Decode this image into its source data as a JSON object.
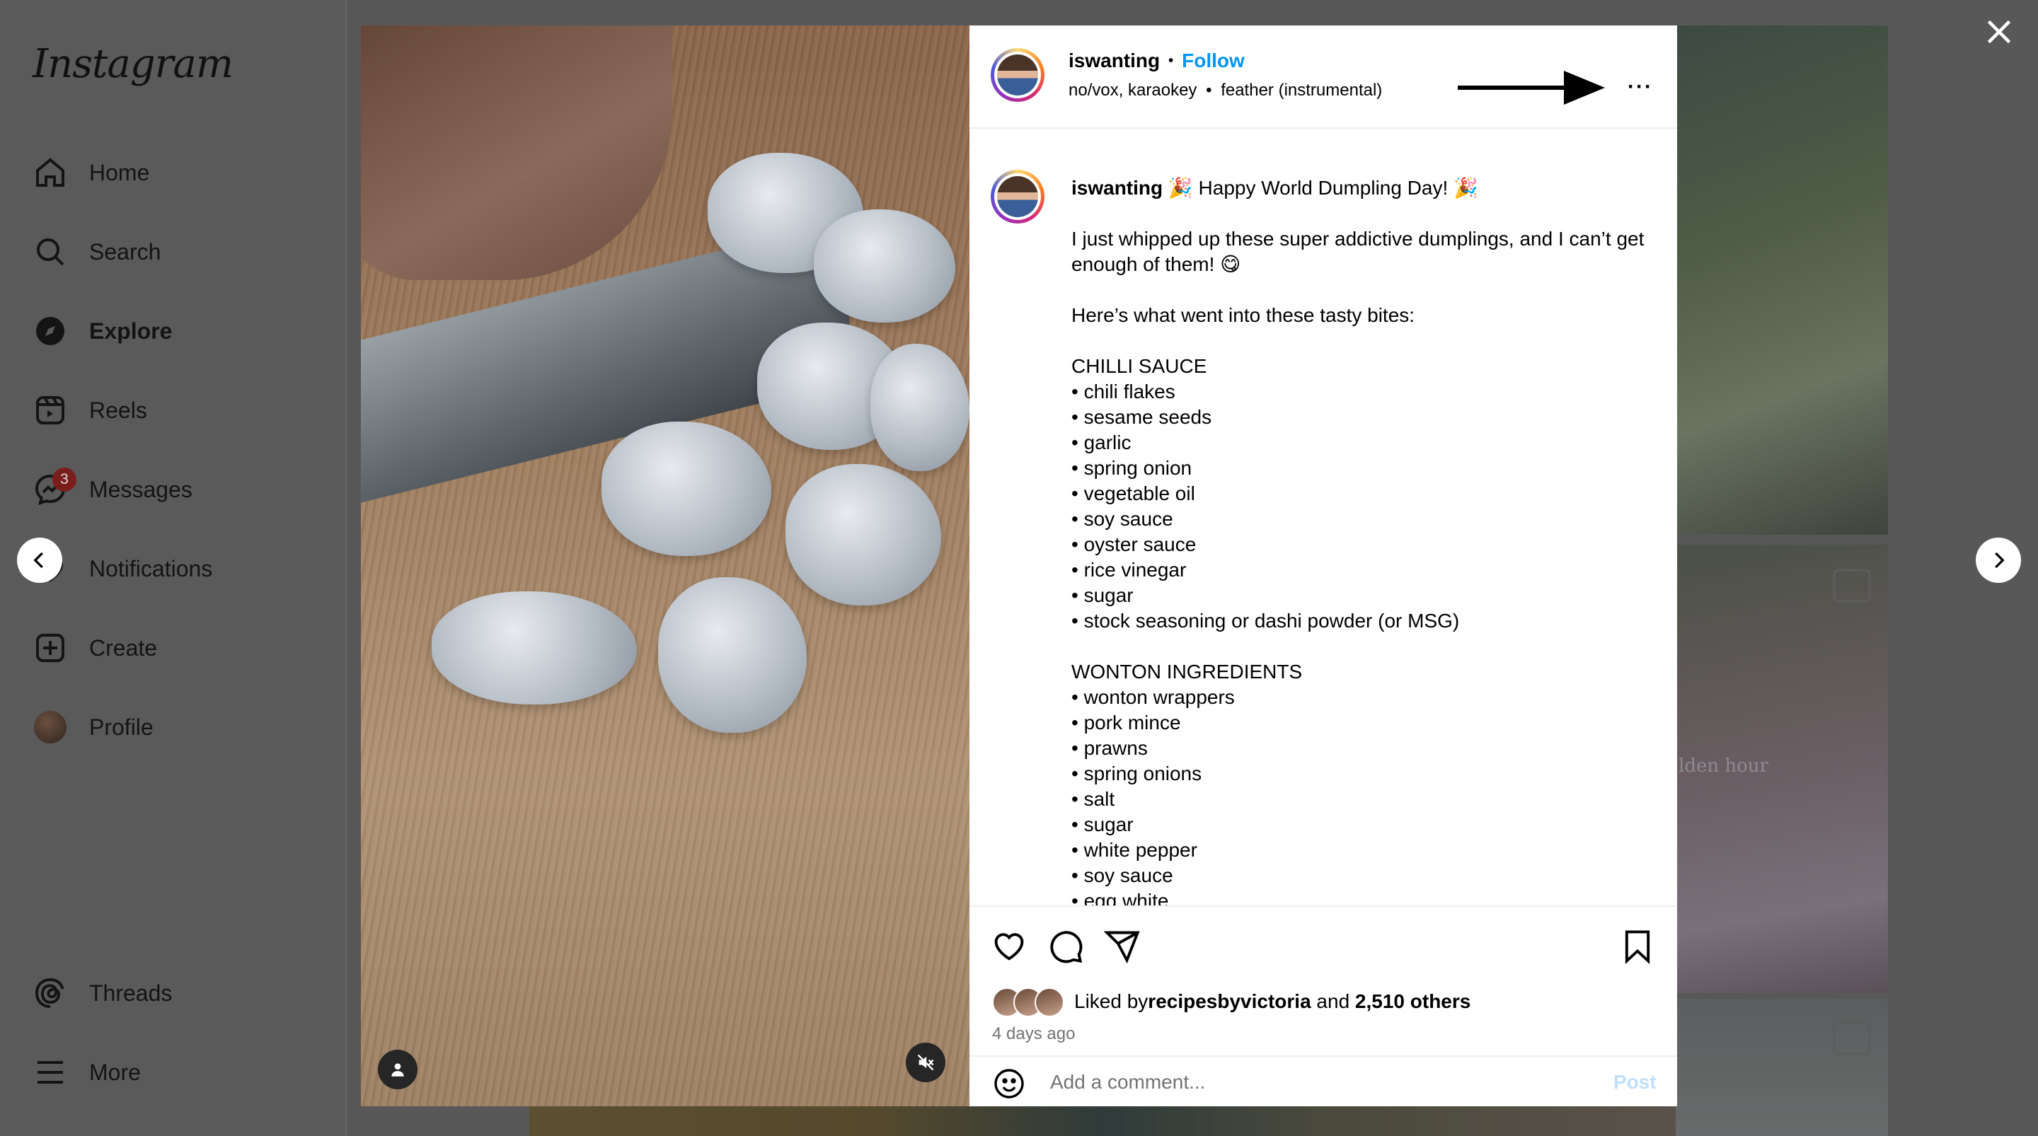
{
  "sidebar": {
    "logo": "Instagram",
    "items": [
      {
        "label": "Home",
        "icon": "home-icon"
      },
      {
        "label": "Search",
        "icon": "search-icon"
      },
      {
        "label": "Explore",
        "icon": "compass-icon"
      },
      {
        "label": "Reels",
        "icon": "reels-icon"
      },
      {
        "label": "Messages",
        "icon": "messenger-icon",
        "badge": "3"
      },
      {
        "label": "Notifications",
        "icon": "heart-icon"
      },
      {
        "label": "Create",
        "icon": "plus-square-icon"
      },
      {
        "label": "Profile",
        "icon": "avatar"
      },
      {
        "label": "Threads",
        "icon": "threads-icon"
      },
      {
        "label": "More",
        "icon": "menu-icon"
      }
    ]
  },
  "background": {
    "tile_text": "lden hour"
  },
  "post": {
    "username": "iswanting",
    "separator": "•",
    "follow_label": "Follow",
    "audio_left": "no/vox, karaokey",
    "audio_right": "feather (instrumental)",
    "more_label": "···",
    "caption": {
      "username": "iswanting",
      "title": " 🎉 Happy World Dumpling Day! 🎉",
      "lines": [
        "",
        "I just whipped up these super addictive dumplings, and I can’t get enough of them! 😋",
        "",
        "Here’s what went into these tasty bites:",
        "",
        "CHILLI SAUCE",
        "• chili flakes",
        "• sesame seeds",
        "• garlic",
        "• spring onion",
        "• vegetable oil",
        "• soy sauce",
        "• oyster sauce",
        "• rice vinegar",
        "• sugar",
        "• stock seasoning or dashi powder (or MSG)",
        "",
        "WONTON INGREDIENTS",
        "• wonton wrappers",
        "• pork mince",
        "• prawns",
        "• spring onions",
        "• salt",
        "• sugar",
        "• white pepper",
        "• soy sauce",
        "• egg white"
      ]
    },
    "likes": {
      "prefix": "Liked by ",
      "user": "recipesbyvictoria",
      "middle": " and ",
      "count": "2,510 others"
    },
    "time_ago": "4 days ago",
    "comment": {
      "placeholder": "Add a comment...",
      "post_label": "Post"
    }
  },
  "colors": {
    "accent": "#0095f6",
    "post_disabled": "#c0dffd",
    "badge": "#7a1e1c"
  }
}
